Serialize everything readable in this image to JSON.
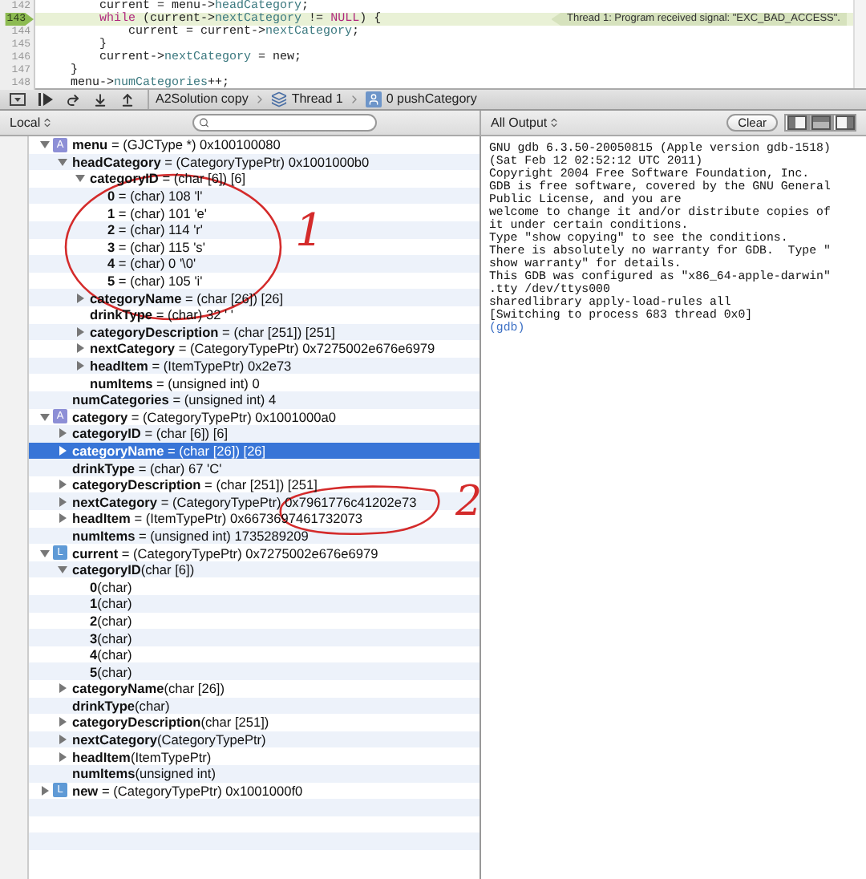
{
  "editor": {
    "lines": [
      {
        "number": "142",
        "current": false,
        "tokens": [
          {
            "text": "        current = menu->",
            "kind": "plain"
          },
          {
            "text": "headCategory",
            "kind": "member"
          },
          {
            "text": ";",
            "kind": "plain"
          }
        ]
      },
      {
        "number": "143",
        "current": true,
        "tokens": [
          {
            "text": "        while",
            "kind": "keyword"
          },
          {
            "text": " (current->",
            "kind": "plain"
          },
          {
            "text": "nextCategory",
            "kind": "member"
          },
          {
            "text": " != ",
            "kind": "plain"
          },
          {
            "text": "NULL",
            "kind": "keyword"
          },
          {
            "text": ") {",
            "kind": "plain"
          }
        ]
      },
      {
        "number": "144",
        "current": false,
        "tokens": [
          {
            "text": "            current = current->",
            "kind": "plain"
          },
          {
            "text": "nextCategory",
            "kind": "member"
          },
          {
            "text": ";",
            "kind": "plain"
          }
        ]
      },
      {
        "number": "145",
        "current": false,
        "tokens": [
          {
            "text": "        }",
            "kind": "plain"
          }
        ]
      },
      {
        "number": "146",
        "current": false,
        "tokens": [
          {
            "text": "        current->",
            "kind": "plain"
          },
          {
            "text": "nextCategory",
            "kind": "member"
          },
          {
            "text": " = new;",
            "kind": "plain"
          }
        ]
      },
      {
        "number": "147",
        "current": false,
        "tokens": [
          {
            "text": "    }",
            "kind": "plain"
          }
        ]
      },
      {
        "number": "148",
        "current": false,
        "tokens": [
          {
            "text": "    menu->",
            "kind": "plain"
          },
          {
            "text": "numCategories",
            "kind": "member"
          },
          {
            "text": "++;",
            "kind": "plain"
          }
        ]
      }
    ],
    "banner": "Thread 1: Program received signal:  \"EXC_BAD_ACCESS\"."
  },
  "debug_bar": {
    "breadcrumbs": [
      {
        "label": "A2Solution copy",
        "kind": "project"
      },
      {
        "label": "Thread 1",
        "kind": "thread"
      },
      {
        "label": "0 pushCategory",
        "kind": "frame"
      }
    ]
  },
  "variables_header": {
    "scope": "Local"
  },
  "variables": [
    {
      "text": "**menu** = (GJCType *) 0x100100080",
      "badge": {
        "letter": "A",
        "kind": "argument"
      },
      "expanded": true,
      "selected": false,
      "children": [
        {
          "text": "**headCategory** = (CategoryTypePtr) 0x1001000b0",
          "expanded": true,
          "selected": false,
          "children": [
            {
              "text": "**categoryID** = (char [6]) [6]",
              "expanded": true,
              "selected": false,
              "children": [
                {
                  "text": "**0** = (char) 108 'l'",
                  "selected": false
                },
                {
                  "text": "**1** = (char) 101 'e'",
                  "selected": false
                },
                {
                  "text": "**2** = (char) 114 'r'",
                  "selected": false
                },
                {
                  "text": "**3** = (char) 115 's'",
                  "selected": false
                },
                {
                  "text": "**4** = (char) 0 '\\0'",
                  "selected": false
                },
                {
                  "text": "**5** = (char) 105 'i'",
                  "selected": false
                }
              ]
            },
            {
              "text": "**categoryName** = (char [26]) [26]",
              "expanded": false,
              "selected": false
            },
            {
              "text": "**drinkType** = (char) 32 ' '",
              "selected": false
            },
            {
              "text": "**categoryDescription** = (char [251]) [251]",
              "expanded": false,
              "selected": false
            },
            {
              "text": "**nextCategory** = (CategoryTypePtr) 0x7275002e676e6979",
              "expanded": false,
              "selected": false
            },
            {
              "text": "**headItem** = (ItemTypePtr) 0x2e73",
              "expanded": false,
              "selected": false
            },
            {
              "text": "**numItems** = (unsigned int) 0",
              "selected": false
            }
          ]
        },
        {
          "text": "**numCategories** = (unsigned int) 4",
          "selected": false
        }
      ]
    },
    {
      "text": "**category** = (CategoryTypePtr) 0x1001000a0",
      "badge": {
        "letter": "A",
        "kind": "argument"
      },
      "expanded": true,
      "selected": false,
      "children": [
        {
          "text": "**categoryID** = (char [6]) [6]",
          "expanded": false,
          "selected": false
        },
        {
          "text": "**categoryName** = (char [26]) [26]",
          "expanded": false,
          "selected": true
        },
        {
          "text": "**drinkType** = (char) 67 'C'",
          "selected": false
        },
        {
          "text": "**categoryDescription** = (char [251]) [251]",
          "expanded": false,
          "selected": false
        },
        {
          "text": "**nextCategory** = (CategoryTypePtr) 0x7961776c41202e73",
          "expanded": false,
          "selected": false
        },
        {
          "text": "**headItem** = (ItemTypePtr) 0x6673697461732073",
          "expanded": false,
          "selected": false
        },
        {
          "text": "**numItems** = (unsigned int) 1735289209",
          "selected": false
        }
      ]
    },
    {
      "text": "**current** = (CategoryTypePtr) 0x7275002e676e6979",
      "badge": {
        "letter": "L",
        "kind": "local"
      },
      "expanded": true,
      "selected": false,
      "children": [
        {
          "text": "**categoryID**(char [6])",
          "expanded": true,
          "selected": false,
          "children": [
            {
              "text": "**0**(char)",
              "selected": false
            },
            {
              "text": "**1**(char)",
              "selected": false
            },
            {
              "text": "**2**(char)",
              "selected": false
            },
            {
              "text": "**3**(char)",
              "selected": false
            },
            {
              "text": "**4**(char)",
              "selected": false
            },
            {
              "text": "**5**(char)",
              "selected": false
            }
          ]
        },
        {
          "text": "**categoryName**(char [26])",
          "expanded": false,
          "selected": false
        },
        {
          "text": "**drinkType**(char)",
          "selected": false
        },
        {
          "text": "**categoryDescription**(char [251])",
          "expanded": false,
          "selected": false
        },
        {
          "text": "**nextCategory**(CategoryTypePtr)",
          "expanded": false,
          "selected": false
        },
        {
          "text": "**headItem**(ItemTypePtr)",
          "expanded": false,
          "selected": false
        },
        {
          "text": "**numItems**(unsigned int)",
          "selected": false
        }
      ]
    },
    {
      "text": "**new** = (CategoryTypePtr) 0x1001000f0",
      "badge": {
        "letter": "L",
        "kind": "local"
      },
      "expanded": false,
      "selected": false
    }
  ],
  "annotations": [
    {
      "label": "1"
    },
    {
      "label": "2"
    }
  ],
  "console_header": {
    "output": "All Output",
    "clear": "Clear",
    "views": [
      {
        "kind": "left",
        "selected": false
      },
      {
        "kind": "both",
        "selected": true
      },
      {
        "kind": "right",
        "selected": false
      }
    ]
  },
  "console": {
    "lines": [
      "GNU gdb 6.3.50-20050815 (Apple version gdb-1518)",
      "(Sat Feb 12 02:52:12 UTC 2011)",
      "Copyright 2004 Free Software Foundation, Inc.",
      "GDB is free software, covered by the GNU General",
      "Public License, and you are",
      "welcome to change it and/or distribute copies of",
      "it under certain conditions.",
      "Type \"show copying\" to see the conditions.",
      "There is absolutely no warranty for GDB.  Type \"",
      "show warranty\" for details.",
      "This GDB was configured as \"x86_64-apple-darwin\"",
      ".tty /dev/ttys000",
      "sharedlibrary apply-load-rules all",
      "[Switching to process 683 thread 0x0]"
    ],
    "prompt": "(gdb)"
  }
}
